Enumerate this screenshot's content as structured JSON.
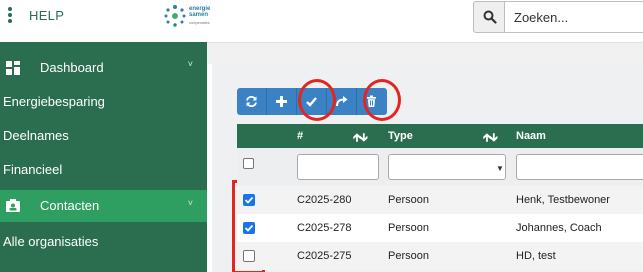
{
  "header": {
    "menu_icon": "kebab-vertical-icon",
    "help_label": "HELP",
    "logo": {
      "text_line1": "energie",
      "text_line2": "samen",
      "sub": "coöperaties",
      "color": "#2b7fa3"
    },
    "search": {
      "icon": "search-icon",
      "placeholder": "Zoeken..."
    }
  },
  "sidebar": {
    "color": "#2b6e4f",
    "active_color": "#2f9e61",
    "items": [
      {
        "label": "Dashboard",
        "icon": "dashboard-icon",
        "has_chevron": true,
        "active": false
      },
      {
        "label": "Energiebesparing",
        "icon": "",
        "has_chevron": false,
        "active": false
      },
      {
        "label": "Deelnames",
        "icon": "",
        "has_chevron": false,
        "active": false
      },
      {
        "label": "Financieel",
        "icon": "",
        "has_chevron": false,
        "active": false
      },
      {
        "label": "Contacten",
        "icon": "contact-card-icon",
        "has_chevron": true,
        "active": true
      },
      {
        "label": "Alle organisaties",
        "icon": "",
        "has_chevron": false,
        "active": false
      }
    ]
  },
  "toolbar": {
    "buttons": [
      {
        "icon": "refresh-icon"
      },
      {
        "icon": "plus-icon"
      },
      {
        "icon": "checkmark-icon",
        "highlighted": true
      },
      {
        "icon": "share-arrow-icon"
      },
      {
        "icon": "trash-icon",
        "highlighted": true
      }
    ],
    "color": "#3b82c4",
    "highlight_color": "#e3251f"
  },
  "table": {
    "columns": [
      {
        "label": "#",
        "sort_icon": "sort-arrows-icon"
      },
      {
        "label": "Type",
        "sort_icon": "sort-arrows-icon"
      },
      {
        "label": "Naam",
        "sort_icon": ""
      }
    ],
    "filters": {
      "number": "",
      "type": "",
      "name": ""
    },
    "rows": [
      {
        "checked": true,
        "number": "C2025-280",
        "type": "Persoon",
        "name": "Henk, Testbewoner"
      },
      {
        "checked": true,
        "number": "C2025-278",
        "type": "Persoon",
        "name": "Johannes, Coach"
      },
      {
        "checked": false,
        "number": "C2025-275",
        "type": "Persoon",
        "name": "HD, test"
      }
    ]
  }
}
